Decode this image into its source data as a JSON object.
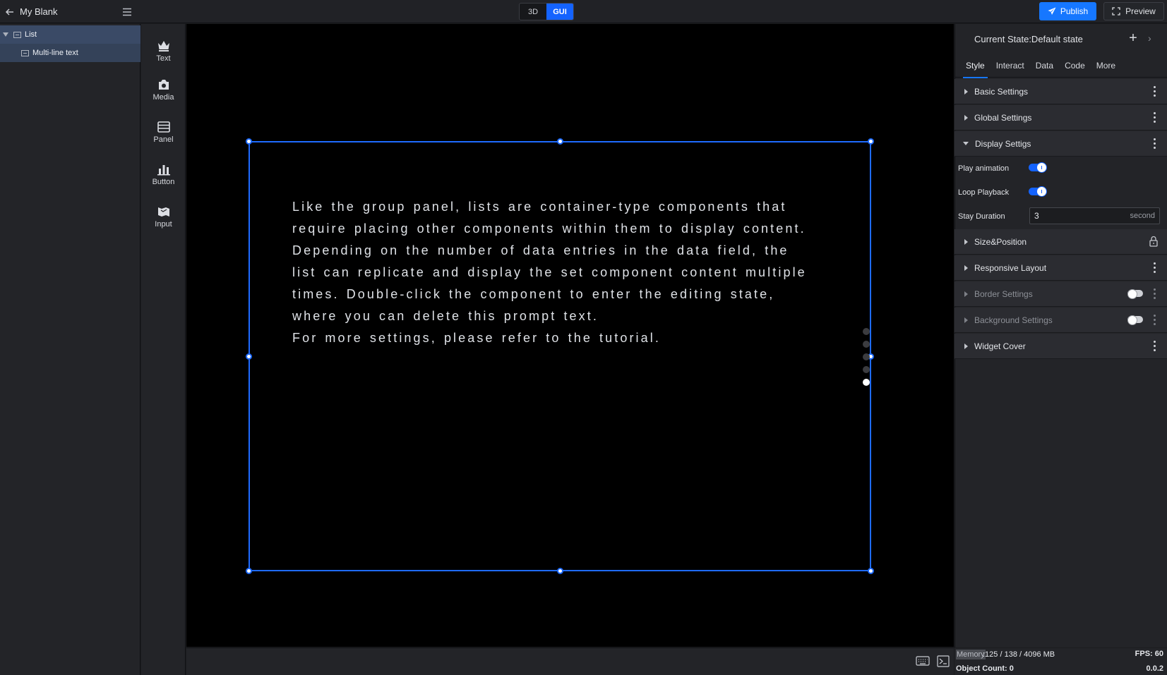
{
  "header": {
    "project_title": "My Blank",
    "modes": [
      "3D",
      "GUI"
    ],
    "active_mode": "GUI",
    "publish_label": "Publish",
    "preview_label": "Preview",
    "accent_color": "#1677ff"
  },
  "layers": {
    "items": [
      {
        "label": "List",
        "expanded": true
      },
      {
        "label": "Multi-line text"
      }
    ]
  },
  "components": {
    "items": [
      {
        "label": "Text",
        "icon": "crown-icon"
      },
      {
        "label": "Media",
        "icon": "camera-icon"
      },
      {
        "label": "Panel",
        "icon": "panel-icon"
      },
      {
        "label": "Button",
        "icon": "bar-chart-icon"
      },
      {
        "label": "Input",
        "icon": "map-icon"
      }
    ]
  },
  "canvas": {
    "prompt_lines": [
      "Like the group panel, lists are container-type components that",
      "require placing other components within them to display content.",
      "Depending on the number of data entries in the data field, the",
      "list can replicate and display the set component content multiple",
      "times. Double-click the component to enter the editing state,",
      "where you can delete this prompt text.",
      "For more settings, please refer to the tutorial."
    ],
    "pager_total": 5,
    "pager_active": 5
  },
  "properties": {
    "current_state": "Current State:Default state",
    "tabs": [
      "Style",
      "Interact",
      "Data",
      "Code",
      "More"
    ],
    "active_tab": "Style",
    "sections": {
      "basic": "Basic Settings",
      "global": "Global Settings",
      "display": "Display Settigs",
      "size": "Size&Position",
      "responsive": "Responsive Layout",
      "border": "Border Settings",
      "background": "Background Settings",
      "cover": "Widget Cover"
    },
    "display": {
      "play_animation_label": "Play animation",
      "play_animation": true,
      "loop_playback_label": "Loop Playback",
      "loop_playback": true,
      "stay_duration_label": "Stay Duration",
      "stay_duration_value": "3",
      "stay_duration_unit": "second"
    }
  },
  "status": {
    "memory_label": "Memory",
    "memory_value": ":125 / 138 / 4096 MB",
    "fps": "FPS: 60",
    "object_count": "Object Count: 0",
    "version": "0.0.2"
  }
}
